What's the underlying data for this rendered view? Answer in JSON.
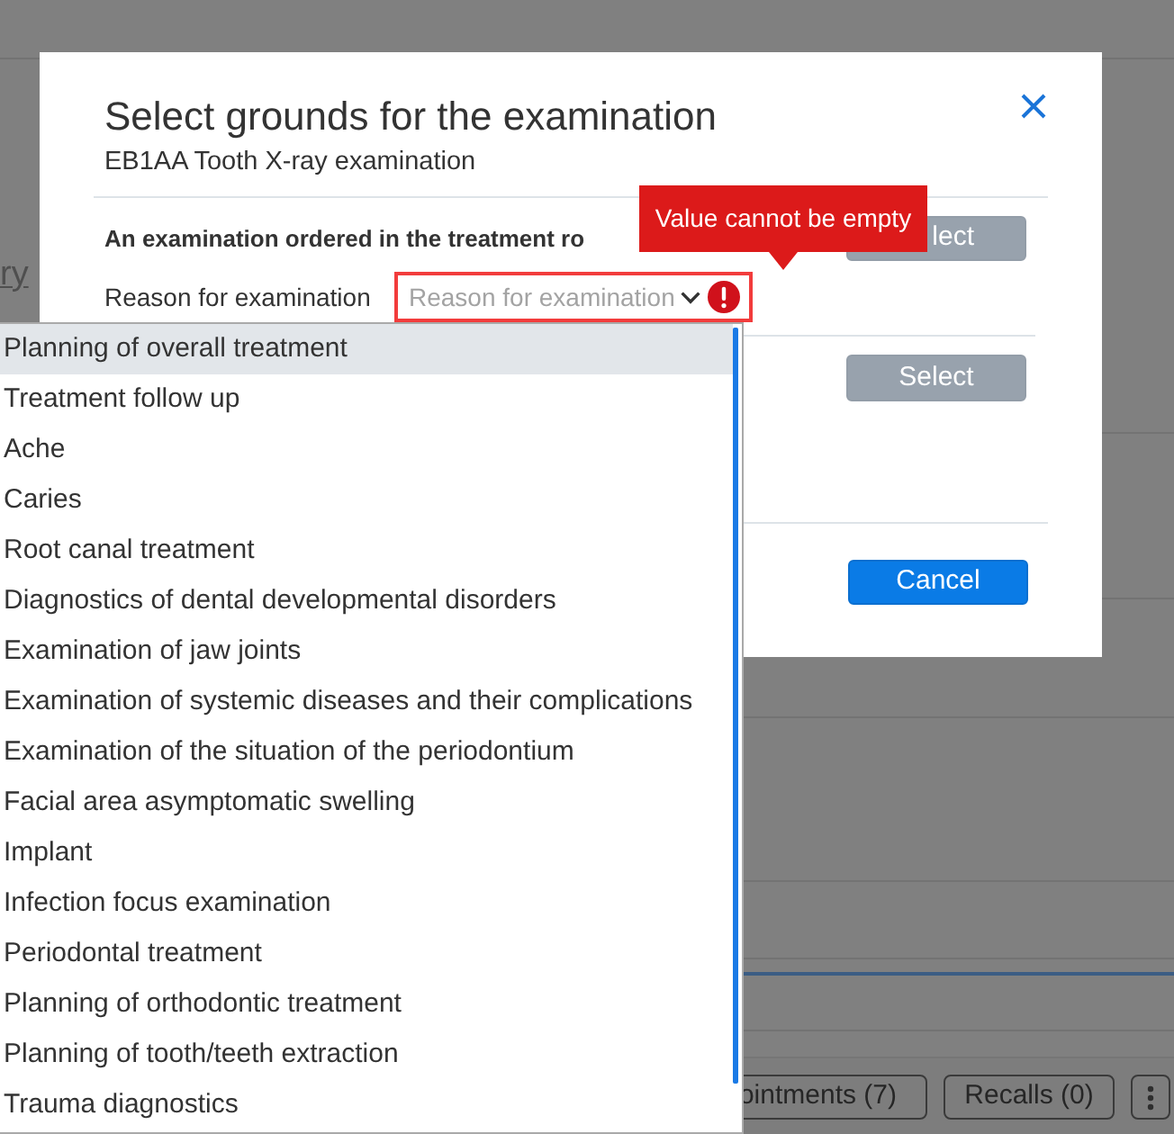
{
  "page": {
    "link_fragment": "ry",
    "buttons": [
      {
        "label": "ointments (7)"
      },
      {
        "label": "Recalls (0)"
      }
    ]
  },
  "dialog": {
    "title": "Select grounds for the examination",
    "subtitle": "EB1AA Tooth X-ray examination",
    "sections": [
      {
        "heading": "An examination ordered in the treatment ro",
        "select_button": {
          "label": "lect",
          "disabled": true
        },
        "field": {
          "label": "Reason for examination",
          "placeholder": "Reason for examination",
          "error": true,
          "error_tooltip": "Value cannot be empty",
          "expanded": true,
          "options": [
            {
              "label": "Planning of overall treatment",
              "selected": true
            },
            {
              "label": "Treatment follow up",
              "selected": false
            },
            {
              "label": "Ache",
              "selected": false
            },
            {
              "label": "Caries",
              "selected": false
            },
            {
              "label": "Root canal treatment",
              "selected": false
            },
            {
              "label": "Diagnostics of dental developmental disorders",
              "selected": false
            },
            {
              "label": "Examination of jaw joints",
              "selected": false
            },
            {
              "label": "Examination of systemic diseases and their complications",
              "selected": false
            },
            {
              "label": "Examination of the situation of the periodontium",
              "selected": false
            },
            {
              "label": "Facial area asymptomatic swelling",
              "selected": false
            },
            {
              "label": "Implant",
              "selected": false
            },
            {
              "label": "Infection focus examination",
              "selected": false
            },
            {
              "label": "Periodontal treatment",
              "selected": false
            },
            {
              "label": "Planning of orthodontic treatment",
              "selected": false
            },
            {
              "label": "Planning of tooth/teeth extraction",
              "selected": false
            },
            {
              "label": "Trauma diagnostics",
              "selected": false
            }
          ]
        }
      },
      {
        "select_button": {
          "label": "Select",
          "disabled": true
        }
      }
    ],
    "cancel_button": {
      "label": "Cancel",
      "disabled": false
    }
  }
}
